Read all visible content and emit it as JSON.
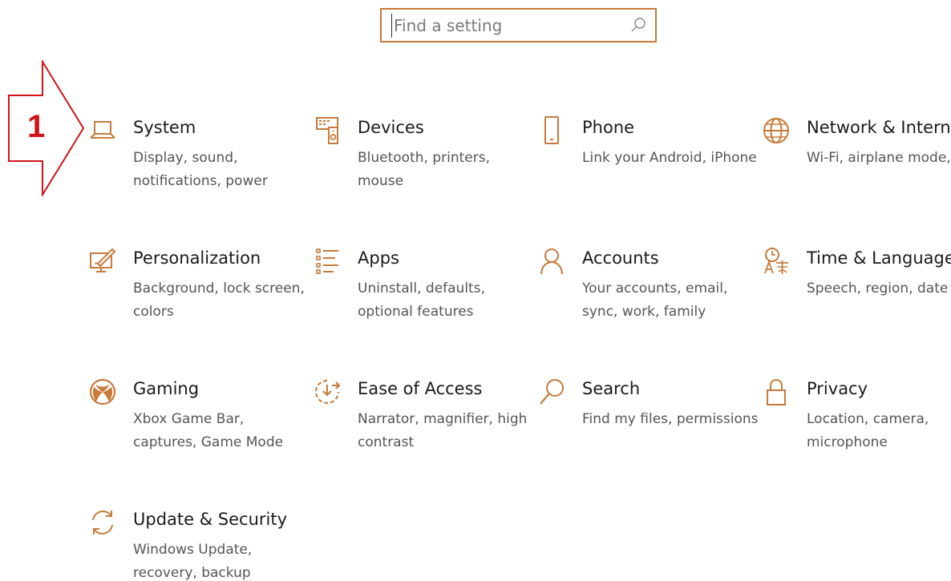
{
  "search": {
    "placeholder": "Find a setting"
  },
  "annotation": {
    "number": "1",
    "color": "#d0141a"
  },
  "accent_color": "#c87a3a",
  "tiles": [
    {
      "icon": "laptop-icon",
      "title": "System",
      "desc": "Display, sound, notifications, power"
    },
    {
      "icon": "devices-icon",
      "title": "Devices",
      "desc": "Bluetooth, printers, mouse"
    },
    {
      "icon": "phone-icon",
      "title": "Phone",
      "desc": "Link your Android, iPhone"
    },
    {
      "icon": "globe-icon",
      "title": "Network & Internet",
      "desc": "Wi-Fi, airplane mode, VPN"
    },
    {
      "icon": "personalization-icon",
      "title": "Personalization",
      "desc": "Background, lock screen, colors"
    },
    {
      "icon": "apps-list-icon",
      "title": "Apps",
      "desc": "Uninstall, defaults, optional features"
    },
    {
      "icon": "person-icon",
      "title": "Accounts",
      "desc": "Your accounts, email, sync, work, family"
    },
    {
      "icon": "time-language-icon",
      "title": "Time & Language",
      "desc": "Speech, region, date"
    },
    {
      "icon": "xbox-icon",
      "title": "Gaming",
      "desc": "Xbox Game Bar, captures, Game Mode"
    },
    {
      "icon": "ease-of-access-icon",
      "title": "Ease of Access",
      "desc": "Narrator, magnifier, high contrast"
    },
    {
      "icon": "search-icon",
      "title": "Search",
      "desc": "Find my files, permissions"
    },
    {
      "icon": "lock-icon",
      "title": "Privacy",
      "desc": "Location, camera, microphone"
    },
    {
      "icon": "update-sync-icon",
      "title": "Update & Security",
      "desc": "Windows Update, recovery, backup"
    }
  ]
}
